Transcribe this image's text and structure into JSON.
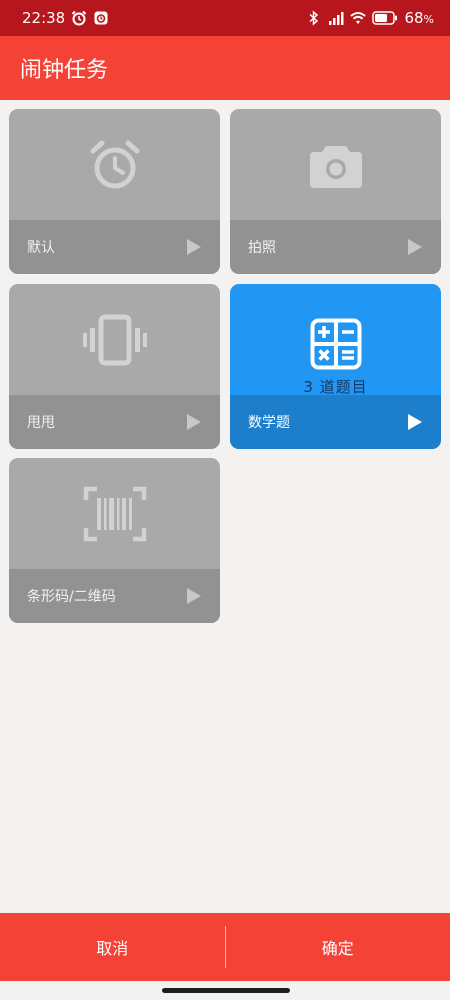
{
  "status_bar": {
    "time": "22:38",
    "battery": "68",
    "battery_unit": "%",
    "icons": [
      "alarm-icon",
      "app-notification-icon",
      "bluetooth-icon",
      "signal-icon",
      "wifi-icon",
      "battery-icon"
    ]
  },
  "app_bar": {
    "title": "闹钟任务"
  },
  "tasks": [
    {
      "label": "默认",
      "icon": "alarm-clock-icon",
      "selected": false
    },
    {
      "label": "拍照",
      "icon": "camera-icon",
      "selected": false
    },
    {
      "label": "甩甩",
      "icon": "vibrate-phone-icon",
      "selected": false
    },
    {
      "label": "数学题",
      "icon": "calculator-icon",
      "selected": true,
      "subtitle": "3 道题目"
    },
    {
      "label": "条形码/二维码",
      "icon": "barcode-scan-icon",
      "selected": false
    }
  ],
  "bottom_bar": {
    "cancel": "取消",
    "confirm": "确定"
  },
  "colors": {
    "status_bar": "#b7161c",
    "app_bar": "#f44236",
    "card_bg": "#a9a9a9",
    "card_selected": "#2196f3",
    "background": "#f3f2f1"
  }
}
